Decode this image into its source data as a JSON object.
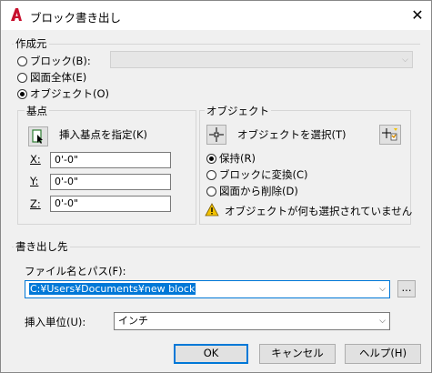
{
  "window": {
    "title": "ブロック書き出し",
    "close_glyph": "✕"
  },
  "source": {
    "group_label": "作成元",
    "options": [
      {
        "label": "ブロック(B):",
        "selected": false
      },
      {
        "label": "図面全体(E)",
        "selected": false
      },
      {
        "label": "オブジェクト(O)",
        "selected": true
      }
    ],
    "block_combo_value": ""
  },
  "basepoint": {
    "group_label": "基点",
    "pick_label": "挿入基点を指定(K)",
    "x_label": "X:",
    "x_value": "0'-0\"",
    "y_label": "Y:",
    "y_value": "0'-0\"",
    "z_label": "Z:",
    "z_value": "0'-0\""
  },
  "objects": {
    "group_label": "オブジェクト",
    "select_label": "オブジェクトを選択(T)",
    "options": [
      {
        "label": "保持(R)",
        "selected": true
      },
      {
        "label": "ブロックに変換(C)",
        "selected": false
      },
      {
        "label": "図面から削除(D)",
        "selected": false
      }
    ],
    "warning": "オブジェクトが何も選択されていません"
  },
  "destination": {
    "group_label": "書き出し先",
    "file_label": "ファイル名とパス(F):",
    "file_value": "C:¥Users¥Documents¥new block",
    "browse_label": "...",
    "units_label": "挿入単位(U):",
    "units_value": "インチ"
  },
  "buttons": {
    "ok": "OK",
    "cancel": "キャンセル",
    "help": "ヘルプ(H)"
  },
  "colors": {
    "accent": "#0078d7",
    "app_icon": "#c8102e",
    "warning": "#f2c200"
  }
}
